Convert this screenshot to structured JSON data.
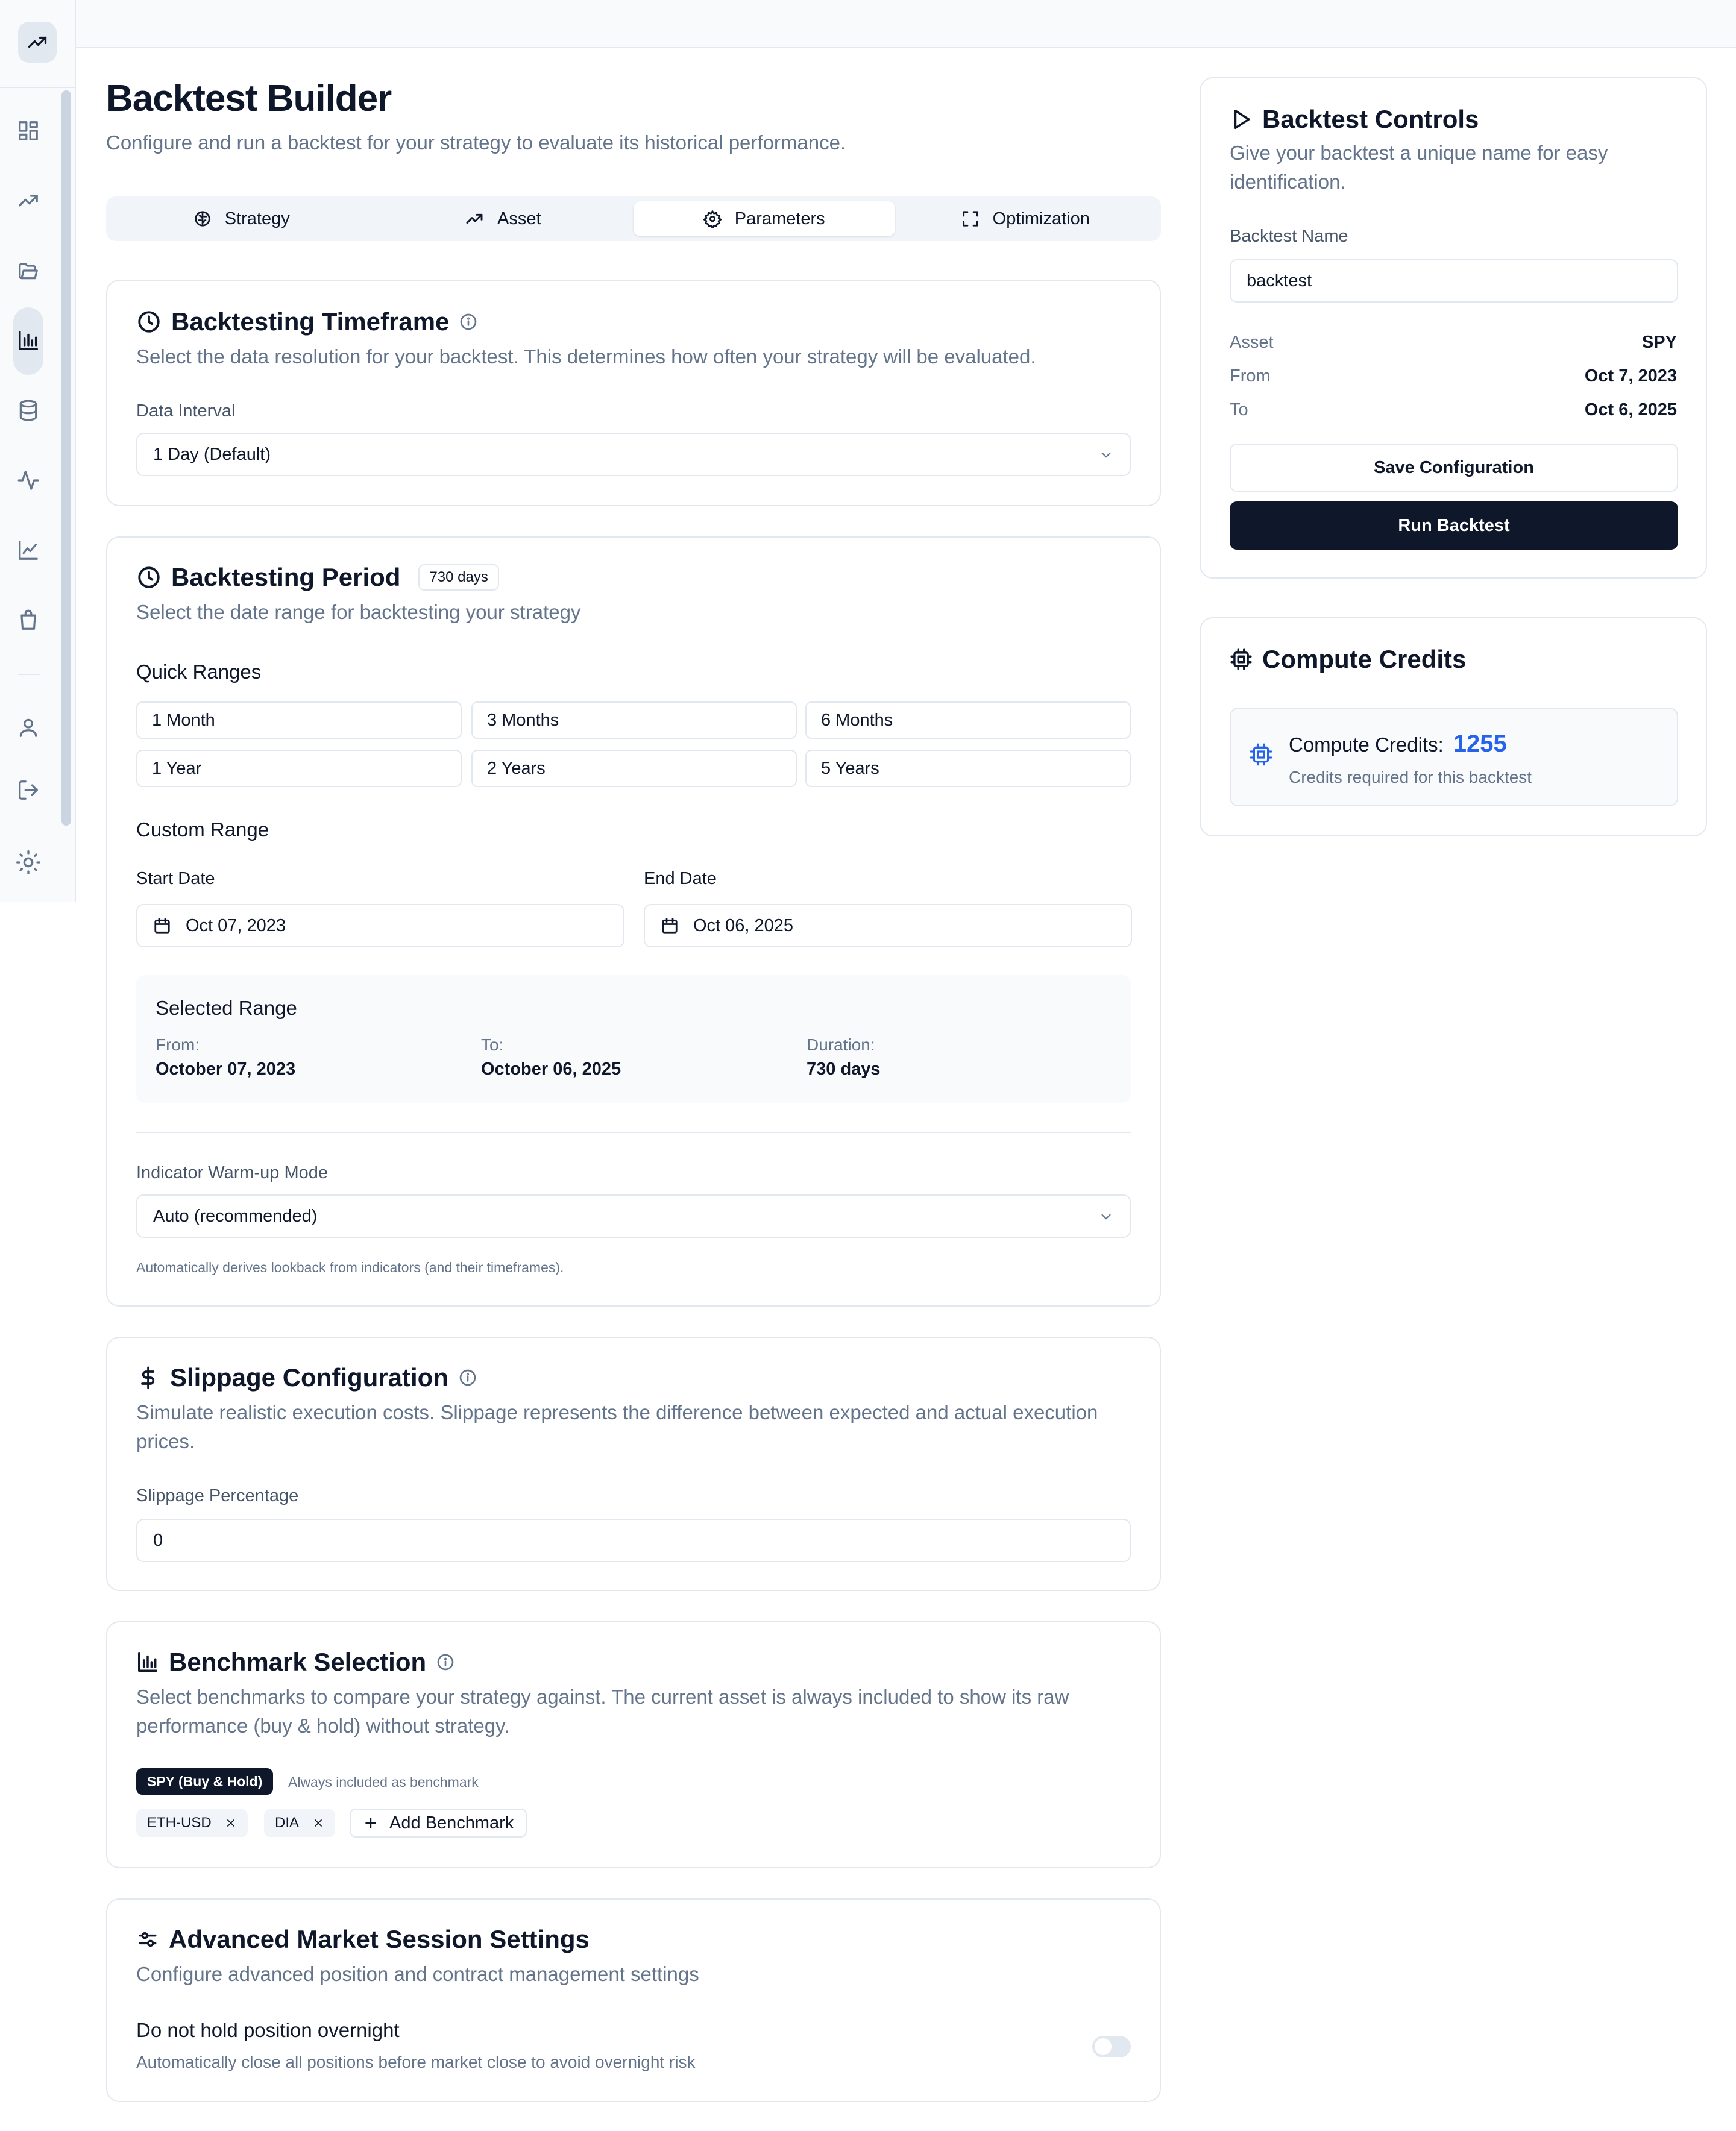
{
  "sidebar": {
    "items": [
      {
        "icon": "dashboard-icon"
      },
      {
        "icon": "trending-icon"
      },
      {
        "icon": "folder-icon"
      },
      {
        "icon": "bar-chart-icon",
        "active": true
      },
      {
        "icon": "database-icon"
      },
      {
        "icon": "activity-icon"
      },
      {
        "icon": "line-chart-icon"
      },
      {
        "icon": "shopping-bag-icon"
      },
      {
        "icon": "user-icon"
      },
      {
        "icon": "logout-icon"
      },
      {
        "icon": "sun-icon"
      }
    ]
  },
  "header": {
    "title": "Backtest Builder",
    "subtitle": "Configure and run a backtest for your strategy to evaluate its historical performance."
  },
  "tabs": [
    {
      "label": "Strategy",
      "icon": "brain-icon"
    },
    {
      "label": "Asset",
      "icon": "trending-icon"
    },
    {
      "label": "Parameters",
      "icon": "gear-icon",
      "active": true
    },
    {
      "label": "Optimization",
      "icon": "expand-icon"
    }
  ],
  "timeframe": {
    "title": "Backtesting Timeframe",
    "description": "Select the data resolution for your backtest. This determines how often your strategy will be evaluated.",
    "interval_label": "Data Interval",
    "interval_value": "1 Day (Default)"
  },
  "period": {
    "title": "Backtesting Period",
    "days_badge": "730 days",
    "description": "Select the date range for backtesting your strategy",
    "quick_ranges_label": "Quick Ranges",
    "quick_ranges": [
      "1 Month",
      "3 Months",
      "6 Months",
      "1 Year",
      "2 Years",
      "5 Years"
    ],
    "custom_range_label": "Custom Range",
    "start_label": "Start Date",
    "start_value": "Oct 07, 2023",
    "end_label": "End Date",
    "end_value": "Oct 06, 2025",
    "selected": {
      "title": "Selected Range",
      "from_label": "From:",
      "from_value": "October 07, 2023",
      "to_label": "To:",
      "to_value": "October 06, 2025",
      "duration_label": "Duration:",
      "duration_value": "730 days"
    },
    "warmup_label": "Indicator Warm-up Mode",
    "warmup_value": "Auto (recommended)",
    "warmup_hint": "Automatically derives lookback from indicators (and their timeframes)."
  },
  "slippage": {
    "title": "Slippage Configuration",
    "description": "Simulate realistic execution costs. Slippage represents the difference between expected and actual execution prices.",
    "label": "Slippage Percentage",
    "value": "0"
  },
  "benchmark": {
    "title": "Benchmark Selection",
    "description": "Select benchmarks to compare your strategy against. The current asset is always included to show its raw performance (buy & hold) without strategy.",
    "fixed_chip": "SPY (Buy & Hold)",
    "fixed_note": "Always included as benchmark",
    "chips": [
      "ETH-USD",
      "DIA"
    ],
    "add_label": "Add Benchmark"
  },
  "advanced": {
    "title": "Advanced Market Session Settings",
    "description": "Configure advanced position and contract management settings",
    "overnight_title": "Do not hold position overnight",
    "overnight_desc": "Automatically close all positions before market close to avoid overnight risk",
    "overnight_enabled": false
  },
  "controls": {
    "title": "Backtest Controls",
    "description": "Give your backtest a unique name for easy identification.",
    "name_label": "Backtest Name",
    "name_value": "backtest",
    "asset_label": "Asset",
    "asset_value": "SPY",
    "from_label": "From",
    "from_value": "Oct 7, 2023",
    "to_label": "To",
    "to_value": "Oct 6, 2025",
    "save_label": "Save Configuration",
    "run_label": "Run Backtest"
  },
  "credits": {
    "title": "Compute Credits",
    "label": "Compute Credits:",
    "value": "1255",
    "sub": "Credits required for this backtest"
  },
  "colors": {
    "primary": "#0f172a",
    "accent_blue": "#2563eb",
    "muted_text": "#64748b",
    "border": "#e2e8f0"
  }
}
